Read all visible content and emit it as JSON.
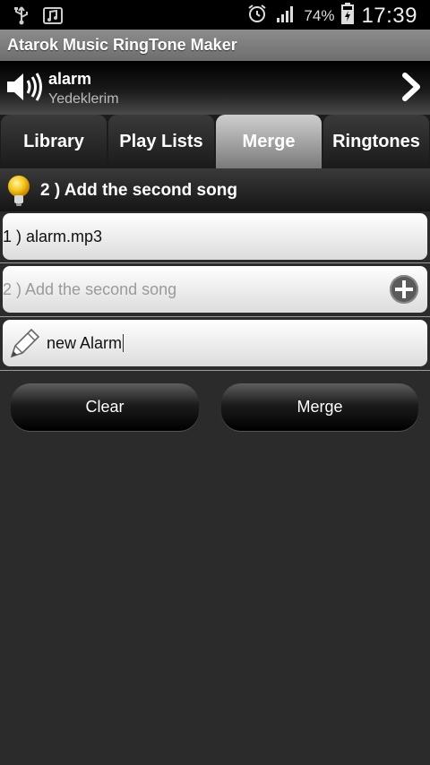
{
  "status_bar": {
    "battery_percent": "74%",
    "time": "17:39",
    "icons": [
      "usb-icon",
      "music-icon",
      "alarm-icon",
      "signal-icon",
      "battery-charging-icon"
    ]
  },
  "app": {
    "title": "Atarok Music RingTone Maker"
  },
  "now_playing": {
    "title": "alarm",
    "subtitle": "Yedeklerim"
  },
  "tabs": [
    {
      "label": "Library",
      "active": false
    },
    {
      "label": "Play Lists",
      "active": false
    },
    {
      "label": "Merge",
      "active": true
    },
    {
      "label": "Ringtones",
      "active": false
    }
  ],
  "hint": {
    "text": "2 ) Add the second song"
  },
  "merge": {
    "first_song": "1 ) alarm.mp3",
    "second_song_placeholder": "2 ) Add the second song",
    "output_name": "new Alarm"
  },
  "buttons": {
    "clear_label": "Clear",
    "merge_label": "Merge"
  }
}
